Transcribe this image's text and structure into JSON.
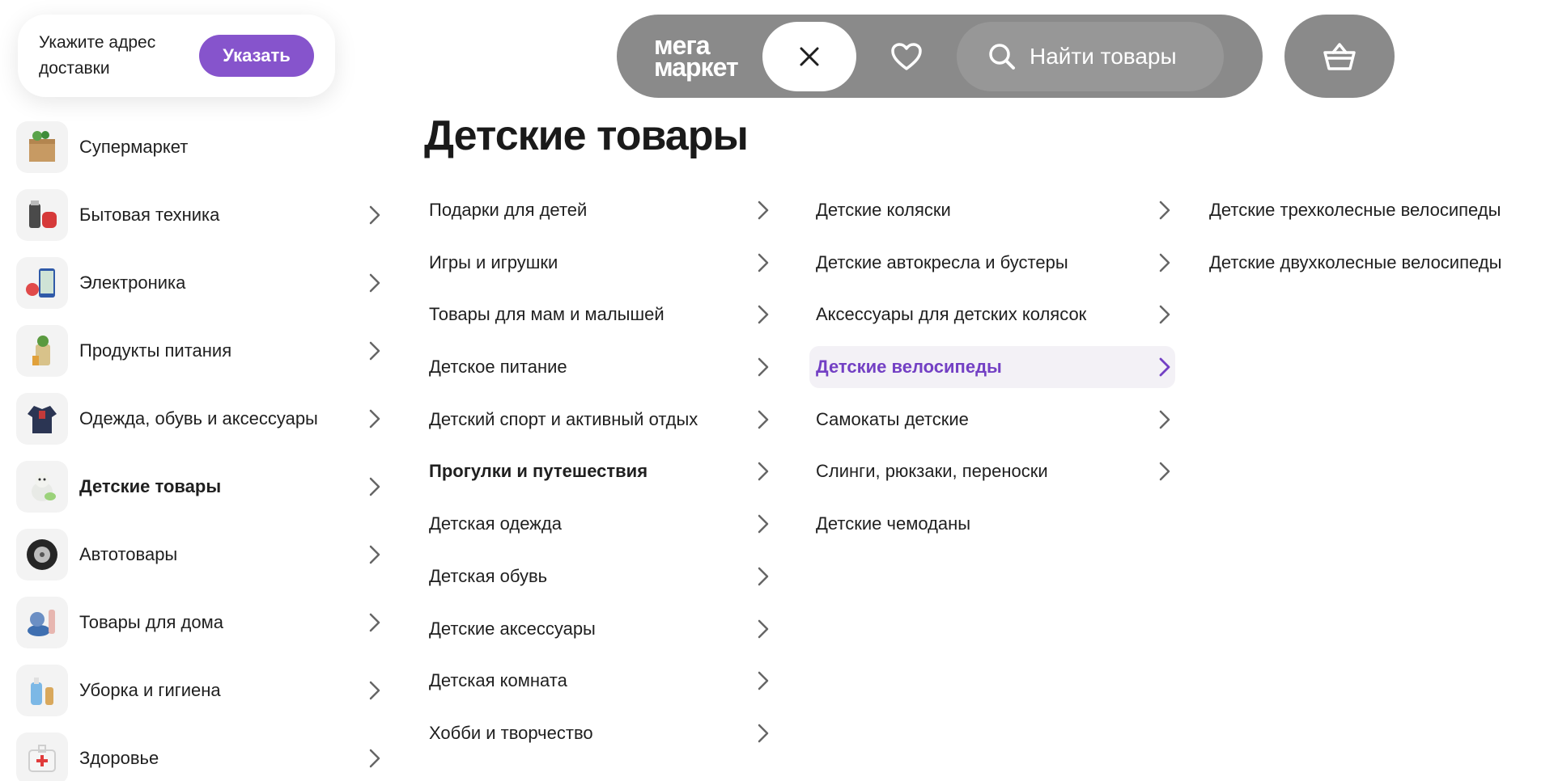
{
  "address": {
    "prompt": "Укажите адрес доставки",
    "button_label": "Указать"
  },
  "topbar": {
    "logo_line1": "мега",
    "logo_line2": "маркет",
    "search_label": "Найти товары"
  },
  "sidebar": {
    "items": [
      {
        "label": "Супермаркет",
        "icon": "grocery-box-icon",
        "has_chevron": false
      },
      {
        "label": "Бытовая техника",
        "icon": "appliances-icon",
        "has_chevron": true
      },
      {
        "label": "Электроника",
        "icon": "electronics-icon",
        "has_chevron": true
      },
      {
        "label": "Продукты питания",
        "icon": "food-icon",
        "has_chevron": true
      },
      {
        "label": "Одежда, обувь и аксессуары",
        "icon": "clothes-icon",
        "has_chevron": true
      },
      {
        "label": "Детские товары",
        "icon": "kids-toy-icon",
        "has_chevron": true
      },
      {
        "label": "Автотовары",
        "icon": "tire-icon",
        "has_chevron": true
      },
      {
        "label": "Товары для дома",
        "icon": "home-goods-icon",
        "has_chevron": true
      },
      {
        "label": "Уборка и гигиена",
        "icon": "cleaning-icon",
        "has_chevron": true
      },
      {
        "label": "Здоровье",
        "icon": "first-aid-icon",
        "has_chevron": true
      }
    ],
    "active_index": 5
  },
  "main": {
    "title": "Детские товары",
    "column1": [
      "Подарки для детей",
      "Игры и игрушки",
      "Товары для мам и малышей",
      "Детское питание",
      "Детский спорт и активный отдых",
      "Прогулки и путешествия",
      "Детская одежда",
      "Детская обувь",
      "Детские аксессуары",
      "Детская комната",
      "Хобби и творчество"
    ],
    "column2": [
      "Детские коляски",
      "Детские автокресла и бустеры",
      "Аксессуары для детских колясок",
      "Детские велосипеды",
      "Самокаты детские",
      "Слинги, рюкзаки, переноски",
      "Детские чемоданы"
    ],
    "column3": [
      "Детские трехколесные велосипеды",
      "Детские двухколесные велосипеды"
    ]
  },
  "colors": {
    "accent": "#8654cc",
    "highlight_text": "#7340c4",
    "topbar": "#8a8a8a"
  }
}
